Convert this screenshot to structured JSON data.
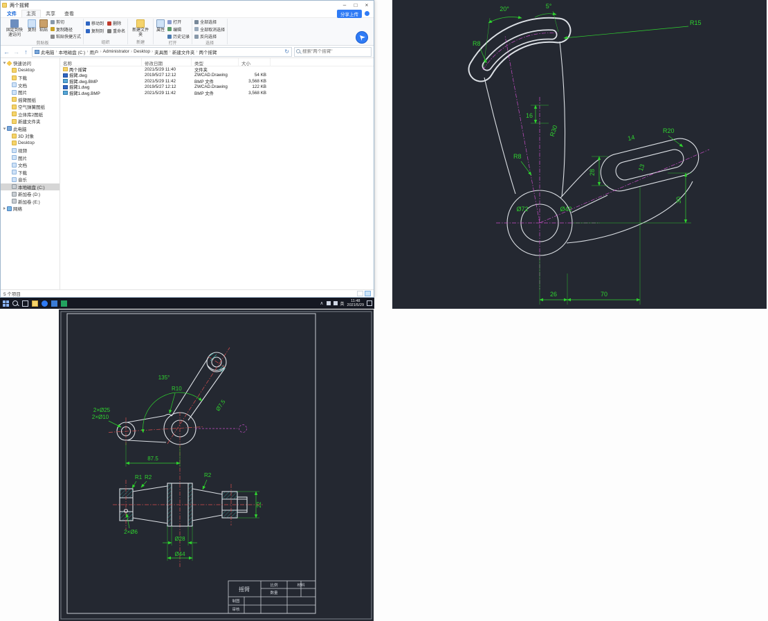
{
  "explorer": {
    "titlebar": {
      "title": "两个摇臂"
    },
    "window_controls": {
      "minimize": "–",
      "maximize": "□",
      "close": "×"
    },
    "tabs": {
      "file": "文件",
      "home": "主页",
      "share": "共享",
      "view": "查看"
    },
    "share_upload": "分享上传",
    "ribbon": {
      "pin": "固定到快速访问",
      "copy": "复制",
      "paste": "粘贴",
      "cut": "剪切",
      "copy_path": "复制路径",
      "paste_shortcut": "粘贴快捷方式",
      "clipboard_group": "剪贴板",
      "move_to": "移动到",
      "copy_to": "复制到",
      "del": "删除",
      "rename": "重命名",
      "organize_group": "组织",
      "new_folder": "新建文件夹",
      "new_group": "新建",
      "properties": "属性",
      "open": "打开",
      "edit": "编辑",
      "history": "历史记录",
      "open_group": "打开",
      "select_all": "全部选择",
      "select_none": "全部取消选择",
      "invert_selection": "反向选择",
      "select_group": "选择"
    },
    "icons": {
      "back": "←",
      "forward": "→",
      "up": "↑",
      "refresh": "↻",
      "dropdown": "∨"
    },
    "address": {
      "crumbs": [
        "此电脑",
        "本地磁盘 (C:)",
        "用户",
        "Administrator",
        "Desktop",
        "夹具图",
        "新建文件夹",
        "两个摇臂"
      ],
      "separator": "›",
      "search_placeholder": "搜索\"两个摇臂\""
    },
    "columns": [
      "名称",
      "修改日期",
      "类型",
      "大小"
    ],
    "files": [
      {
        "name": "两个摇臂",
        "date": "2021/5/29 11:40",
        "type": "文件夹",
        "size": ""
      },
      {
        "name": "摇臂.dwg",
        "date": "2019/5/27 12:12",
        "type": "ZWCAD.Drawing",
        "size": "54 KB"
      },
      {
        "name": "摇臂.dwg.BMP",
        "date": "2021/5/29 11:42",
        "type": "BMP 文件",
        "size": "3,568 KB"
      },
      {
        "name": "摇臂1.dwg",
        "date": "2019/5/27 12:12",
        "type": "ZWCAD.Drawing",
        "size": "122 KB"
      },
      {
        "name": "摇臂1.dwg.BMP",
        "date": "2021/5/29 11:42",
        "type": "BMP 文件",
        "size": "3,568 KB"
      }
    ],
    "nav": {
      "quick_access": "快速访问",
      "quick_items": [
        "Desktop",
        "下载",
        "文档",
        "图片",
        "摇臂图纸",
        "空气弹簧图纸",
        "立体库2图纸",
        "新建文件夹"
      ],
      "this_pc": "此电脑",
      "pc_items": [
        "3D 对象",
        "Desktop",
        "视频",
        "图片",
        "文档",
        "下载",
        "音乐",
        "本地磁盘 (C:)",
        "新加卷 (D:)",
        "新加卷 (E:)"
      ],
      "network": "网络"
    },
    "status": {
      "count": "5 个项目"
    }
  },
  "taskbar": {
    "time": "11:48",
    "date": "2021/5/29",
    "lang": "英",
    "chevron_up": "∧"
  },
  "cad_right": {
    "dims": {
      "a20": "20°",
      "a5": "5°",
      "r15": "R15",
      "r8a": "R8",
      "n16": "16",
      "r30": "R30",
      "r20": "R20",
      "n14": "14",
      "n13": "13",
      "n28": "28",
      "n30": "30",
      "d72": "Ø72",
      "d42": "Ø42",
      "r8b": "R8",
      "n26": "26",
      "n70": "70"
    }
  },
  "cad_bottom": {
    "dims": {
      "a135": "135°",
      "r10": "R10",
      "d75": "Ø7.5",
      "d25": "2×Ø25",
      "d10": "2×Ø10",
      "n875": "87.5",
      "r1": "R1",
      "r2a": "R2",
      "r2b": "R2",
      "d6": "2×Ø6",
      "d28": "Ø28",
      "d44": "Ø44",
      "n22": "22"
    },
    "titleblock": {
      "name": "摇臂",
      "scale": "比例",
      "material": "材料",
      "qty": "数量",
      "draw": "制图",
      "check": "审核"
    }
  }
}
